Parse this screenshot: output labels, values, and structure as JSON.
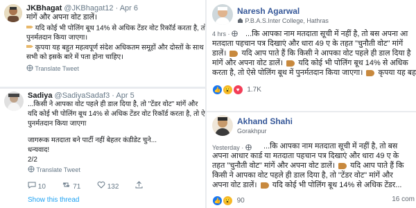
{
  "tweet1": {
    "name": "JKBhagat",
    "handle": "@JKBhagat12",
    "date": "Apr 6",
    "title": "मांगें और अपना वोट डालें।",
    "line1": "यदि कोई भी पोलिंग बूथ 14% से अधिक टेंडर वोट रिकॉर्ड करता है, तो उ",
    "line2": "पुनर्मतदान किया जाएगा।",
    "line3": "कृपया यह बहुत महत्वपूर्ण संदेश अधिकतम समूहों और दोस्तों के साथ सा",
    "line4": "सभी को इसके बारे में पता होना चाहिए।",
    "translate": "Translate Tweet"
  },
  "tweet2": {
    "name": "Sadiya",
    "handle": "@SadiyaSadaf3",
    "date": "Apr 5",
    "line1": "...किसी ने आपका वोट पहले ही डाल दिया है, तो \"टेंडर वोट\" मांगें और",
    "line2": "यदि कोई भी पोलिंग बूथ 14% से अधिक टेंडर वोट रिकॉर्ड करता है, तो ऐसे",
    "line3": "पुनर्मतदान किया जाएगा",
    "line4": "जागरूक मतदाता बने पार्टी नहीं बेहतर कंडीडेट चुने...",
    "line5": "धन्यवाद!",
    "line6": "2/2",
    "translate": "Translate Tweet",
    "replies": "10",
    "retweets": "71",
    "likes": "132",
    "show_thread": "Show this thread"
  },
  "fb1": {
    "name": "Naresh Agarwal",
    "sub": "P.B.A.S.Inter College, Hathras",
    "time": "4 hrs",
    "line1": "...कि आपका नाम मतदाता सूची में नहीं है, तो बस अपना आ",
    "line2": "मतदाता पहचान पत्र दिखाएं और धारा 49 ए के तहत \"चुनौती वोट\" मांगें ",
    "line3": "डालें।",
    "line3b": "यदि आप पाते हैं कि किसी ने आपका वोट पहले ही डाल दिया है",
    "line4": "मांगें और अपना वोट डालें।",
    "line4b": "यदि कोई भी पोलिंग बूथ 14% से अधिक ",
    "line5": "करता है, तो ऐसे पोलिंग बूथ में पुनर्मतदान किया जाएगा।",
    "line5b": "कृपया यह बह",
    "reactions": "1.7K"
  },
  "fb2": {
    "name": "Akhand Shahi",
    "sub": "Gorakhpur",
    "time": "Yesterday",
    "line1": "...कि आपका नाम मतदाता सूची में नहीं है, तो बस",
    "line2": "अपना आधार कार्ड या मतदाता पहचान पत्र दिखाएं और धारा 49 ए के",
    "line3": "तहत \"चुनौती वोट\" मांगें और अपना वोट डालें।",
    "line3b": "यदि आप पाते हैं कि",
    "line4": "किसी ने आपका वोट पहले ही डाल दिया है, तो \"टेंडर वोट\" मांगें और",
    "line5": "अपना वोट डालें।",
    "line5b": "यदि कोई भी पोलिंग बूथ 14% से अधिक टेंडर...",
    "reactions": "90",
    "comments": "16 com"
  }
}
